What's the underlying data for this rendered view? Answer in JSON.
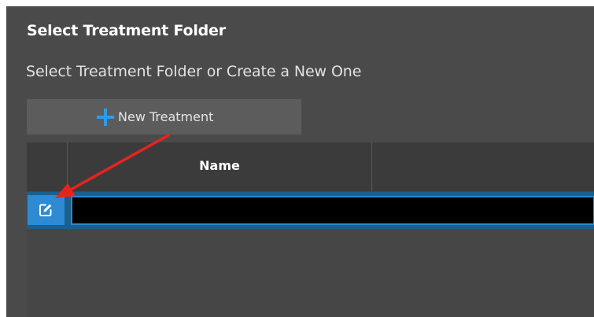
{
  "dialog": {
    "title": "Select Treatment Folder",
    "subtitle": "Select Treatment Folder or Create a New One"
  },
  "toolbar": {
    "new_button_label": "New Treatment",
    "new_button_icon": "plus-icon"
  },
  "table": {
    "columns": [
      "",
      "Name",
      ""
    ],
    "rows": [
      {
        "edit_icon": "edit-icon",
        "name": "",
        "name_redacted": true,
        "selected": true
      }
    ]
  },
  "annotation": {
    "type": "arrow",
    "color": "#e8231f",
    "points_to": "edit-button"
  },
  "colors": {
    "background": "#4a4a4a",
    "accent": "#2d8ad3",
    "header": "#3b3b3b",
    "selected_row": "#1b5f8d"
  }
}
